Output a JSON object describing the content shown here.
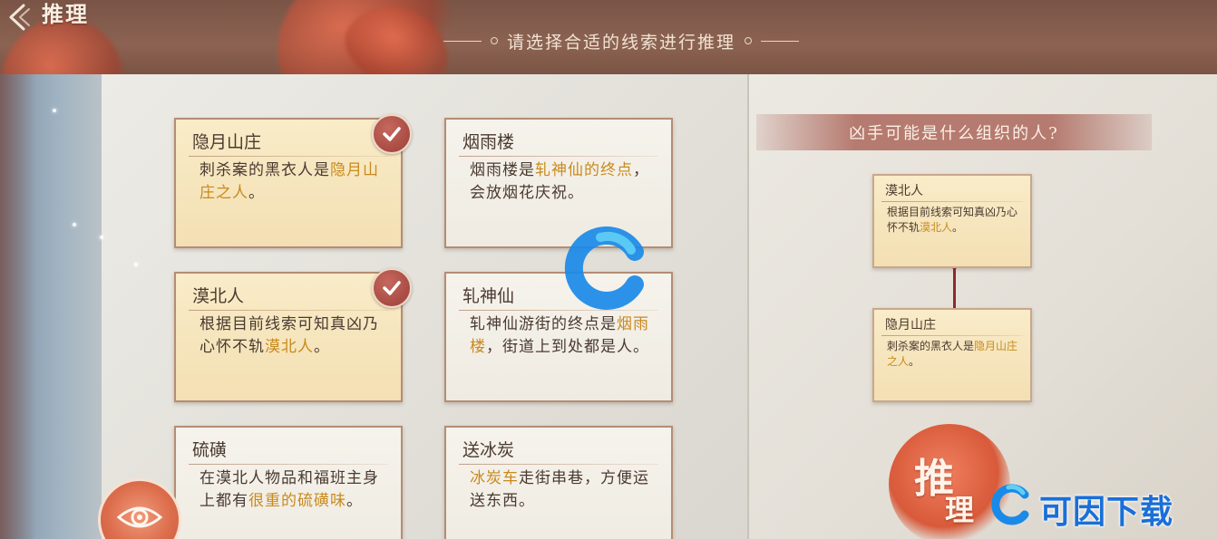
{
  "header": {
    "title": "推理",
    "subtitle": "请选择合适的线索进行推理"
  },
  "clues": [
    {
      "title": "隐月山庄",
      "selected": true,
      "text_parts": [
        {
          "t": "刺杀案的黑衣人是",
          "hl": false
        },
        {
          "t": "隐月山庄之人",
          "hl": true
        },
        {
          "t": "。",
          "hl": false
        }
      ]
    },
    {
      "title": "烟雨楼",
      "selected": false,
      "text_parts": [
        {
          "t": "烟雨楼是",
          "hl": false
        },
        {
          "t": "轧神仙的终点",
          "hl": true
        },
        {
          "t": "，会放烟花庆祝。",
          "hl": false
        }
      ]
    },
    {
      "title": "漠北人",
      "selected": true,
      "text_parts": [
        {
          "t": "根据目前线索可知真凶乃心怀不轨",
          "hl": false
        },
        {
          "t": "漠北人",
          "hl": true
        },
        {
          "t": "。",
          "hl": false
        }
      ]
    },
    {
      "title": "轧神仙",
      "selected": false,
      "text_parts": [
        {
          "t": "轧神仙游街的终点是",
          "hl": false
        },
        {
          "t": "烟雨楼",
          "hl": true
        },
        {
          "t": "，街道上到处都是人。",
          "hl": false
        }
      ]
    },
    {
      "title": "硫磺",
      "selected": false,
      "text_parts": [
        {
          "t": "在漠北人物品和福班主身上都有",
          "hl": false
        },
        {
          "t": "很重的硫磺味",
          "hl": true
        },
        {
          "t": "。",
          "hl": false
        }
      ]
    },
    {
      "title": "送冰炭",
      "selected": false,
      "text_parts": [
        {
          "t": "冰炭车",
          "hl": true
        },
        {
          "t": "走街串巷，方便运送东西。",
          "hl": false
        }
      ]
    }
  ],
  "question": "凶手可能是什么组织的人?",
  "chosen": [
    {
      "title": "漠北人",
      "text_parts": [
        {
          "t": "根据目前线索可知真凶乃心怀不轨",
          "hl": false
        },
        {
          "t": "漠北人",
          "hl": true
        },
        {
          "t": "。",
          "hl": false
        }
      ]
    },
    {
      "title": "隐月山庄",
      "text_parts": [
        {
          "t": "刺杀案的黑衣人是",
          "hl": false
        },
        {
          "t": "隐月山庄之人",
          "hl": true
        },
        {
          "t": "。",
          "hl": false
        }
      ]
    }
  ],
  "reason_button": {
    "char1": "推",
    "char2": "理"
  },
  "watermark": {
    "text": "可因下载"
  },
  "colors": {
    "highlight": "#c98a1c",
    "badge": "#a8453c",
    "button": "#d85a3a",
    "watermark": "#1a6fd8"
  }
}
